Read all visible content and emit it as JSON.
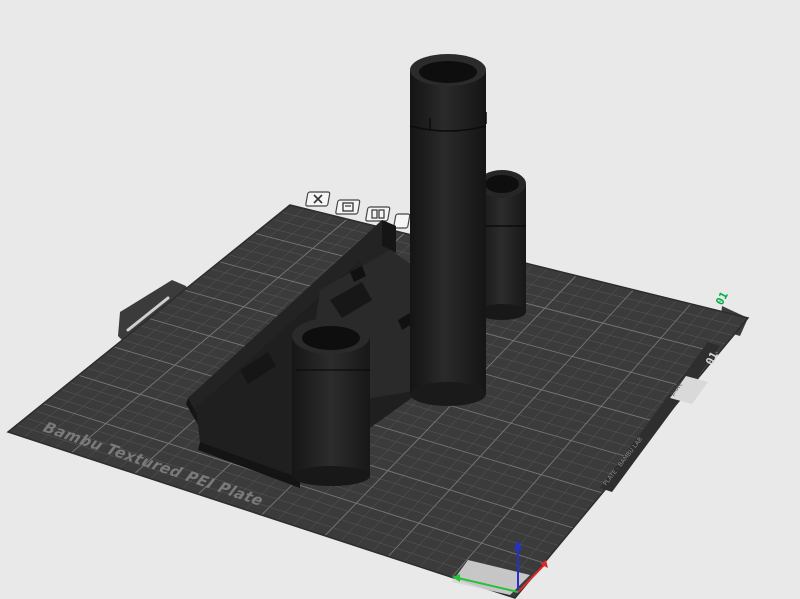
{
  "viewport": {
    "plate_label": "Bambu Textured PEI Plate",
    "plate_number": "01",
    "plate_number_badge": "01"
  },
  "plate_toolbar": {
    "icons": [
      "close-icon",
      "auto-orient-icon",
      "arrange-icon",
      "lock-icon"
    ]
  },
  "colors": {
    "background": "#e9e9ea",
    "plate": "#3b3b3b",
    "grid": "#6a6a6a",
    "model": "#1c1c1c",
    "accent_green": "#00ae42",
    "axis_x": "#d82a2a",
    "axis_y": "#2ac03a",
    "axis_z": "#2233cc"
  }
}
